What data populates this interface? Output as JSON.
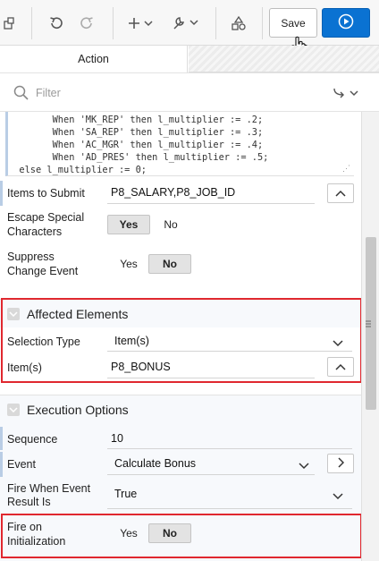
{
  "toolbar": {
    "save_label": "Save",
    "icons": [
      "layout-icon",
      "undo-icon",
      "redo-icon",
      "add-icon",
      "wrench-icon",
      "shapes-icon",
      "play-icon"
    ]
  },
  "tabs": {
    "action_label": "Action"
  },
  "filter": {
    "placeholder": "Filter"
  },
  "code": {
    "lines": [
      "        When 'MK_REP' then l_multiplier := .2;",
      "        When 'SA_REP' then l_multiplier := .3;",
      "        When 'AC_MGR' then l_multiplier := .4;",
      "        When 'AD_PRES' then l_multiplier := .5;",
      "  else l_multiplier := 0;"
    ]
  },
  "items_to_submit": {
    "label": "Items to Submit",
    "value": "P8_SALARY,P8_JOB_ID"
  },
  "escape_special": {
    "label_line1": "Escape Special",
    "label_line2": "Characters",
    "yes": "Yes",
    "no": "No"
  },
  "suppress_change": {
    "label_line1": "Suppress",
    "label_line2": "Change Event",
    "yes": "Yes",
    "no": "No"
  },
  "affected_elements": {
    "title": "Affected Elements",
    "selection_type_label": "Selection Type",
    "selection_type_value": "Item(s)",
    "items_label": "Item(s)",
    "items_value": "P8_BONUS"
  },
  "execution_options": {
    "title": "Execution Options",
    "sequence_label": "Sequence",
    "sequence_value": "10",
    "event_label": "Event",
    "event_value": "Calculate Bonus",
    "fire_when_label_line1": "Fire When Event",
    "fire_when_label_line2": "Result Is",
    "fire_when_value": "True",
    "fire_init_label_line1": "Fire on",
    "fire_init_label_line2": "Initialization",
    "yes": "Yes",
    "no": "No"
  },
  "colors": {
    "accent": "#0a72d2",
    "highlight": "#e0282f"
  }
}
